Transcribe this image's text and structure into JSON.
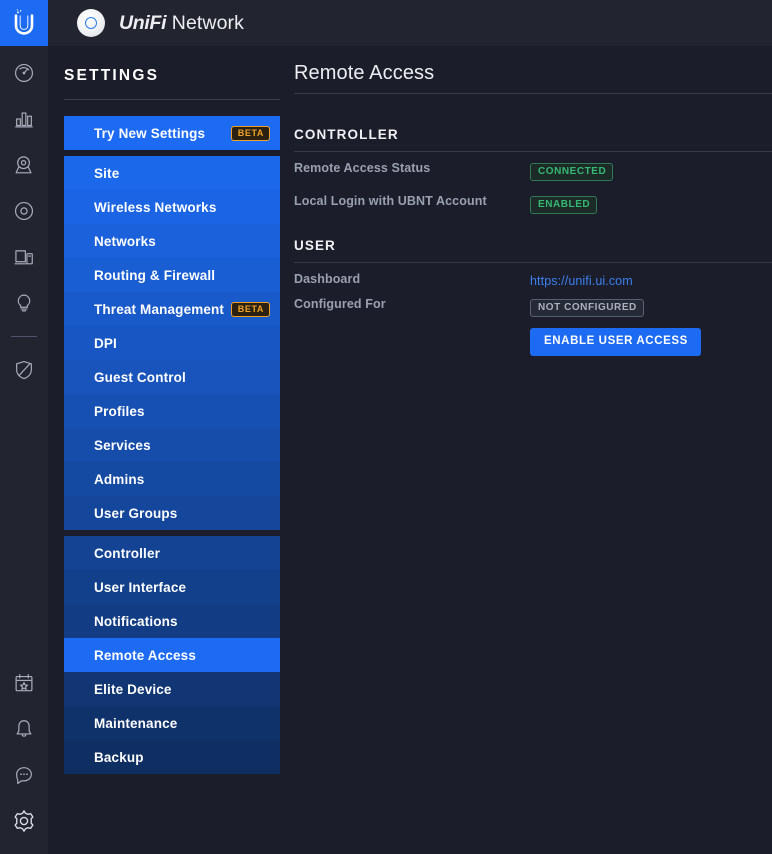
{
  "topbar": {
    "logo_icon": "ubiquiti-u-logo-icon",
    "ap_icon": "access-point-icon",
    "brand_primary": "UniFi",
    "brand_secondary": "Network"
  },
  "rail": {
    "top_items": [
      {
        "icon": "dashboard-gauge-icon",
        "name": "dashboard"
      },
      {
        "icon": "statistics-bars-icon",
        "name": "statistics"
      },
      {
        "icon": "map-pin-icon",
        "name": "map"
      },
      {
        "icon": "devices-circle-icon",
        "name": "devices"
      },
      {
        "icon": "clients-screen-icon",
        "name": "clients"
      },
      {
        "icon": "insights-bulb-icon",
        "name": "insights"
      }
    ],
    "bottom_items": [
      {
        "icon": "events-calendar-star-icon",
        "name": "events"
      },
      {
        "icon": "alerts-bell-icon",
        "name": "alerts"
      },
      {
        "icon": "chat-bubble-icon",
        "name": "chat"
      },
      {
        "icon": "gear-icon",
        "name": "settings"
      }
    ],
    "threat_item": {
      "icon": "shield-slash-icon",
      "name": "threat-management"
    }
  },
  "sidebar": {
    "title": "SETTINGS",
    "group_top": [
      {
        "label": "Try New Settings",
        "badge": "BETA",
        "active": false
      }
    ],
    "group_main": [
      {
        "label": "Site",
        "badge": null,
        "active": false
      },
      {
        "label": "Wireless Networks",
        "badge": null,
        "active": false
      },
      {
        "label": "Networks",
        "badge": null,
        "active": false
      },
      {
        "label": "Routing & Firewall",
        "badge": null,
        "active": false
      },
      {
        "label": "Threat Management",
        "badge": "BETA",
        "active": false
      },
      {
        "label": "DPI",
        "badge": null,
        "active": false
      },
      {
        "label": "Guest Control",
        "badge": null,
        "active": false
      },
      {
        "label": "Profiles",
        "badge": null,
        "active": false
      },
      {
        "label": "Services",
        "badge": null,
        "active": false
      },
      {
        "label": "Admins",
        "badge": null,
        "active": false
      },
      {
        "label": "User Groups",
        "badge": null,
        "active": false
      }
    ],
    "group_controller": [
      {
        "label": "Controller",
        "badge": null,
        "active": false
      },
      {
        "label": "User Interface",
        "badge": null,
        "active": false
      },
      {
        "label": "Notifications",
        "badge": null,
        "active": false
      },
      {
        "label": "Remote Access",
        "badge": null,
        "active": true
      },
      {
        "label": "Elite Device",
        "badge": null,
        "active": false
      },
      {
        "label": "Maintenance",
        "badge": null,
        "active": false
      },
      {
        "label": "Backup",
        "badge": null,
        "active": false
      }
    ]
  },
  "main": {
    "page_title": "Remote Access",
    "section_controller": "CONTROLLER",
    "section_user": "USER",
    "rows": {
      "remote_access_status_label": "Remote Access Status",
      "remote_access_status_value": "CONNECTED",
      "local_login_label": "Local Login with UBNT Account",
      "local_login_value": "ENABLED",
      "dashboard_label": "Dashboard",
      "dashboard_link": "https://unifi.ui.com",
      "configured_for_label": "Configured For",
      "configured_for_value": "NOT CONFIGURED"
    },
    "enable_user_access_button": "ENABLE USER ACCESS"
  },
  "colors": {
    "accent_blue": "#1d6bf3",
    "link_blue": "#3b7ff0",
    "status_green": "#35b972",
    "badge_orange": "#f0a124",
    "bg_dark": "#1b1e2a",
    "bg_panel": "#22252f"
  }
}
